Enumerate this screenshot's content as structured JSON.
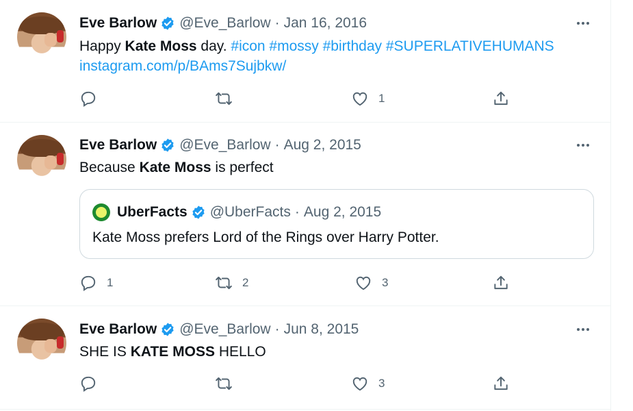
{
  "tweets": [
    {
      "author": {
        "name": "Eve Barlow",
        "handle": "@Eve_Barlow"
      },
      "date": "Jan 16, 2016",
      "text": {
        "t1": "Happy ",
        "b1": "Kate Moss",
        "t2": " day. ",
        "link1": "#icon #mossy #birthday #SUPERLATIVEHUMANS",
        "link2": "instagram.com/p/BAms7Sujbkw/"
      },
      "replies": "",
      "retweets": "",
      "likes": "1"
    },
    {
      "author": {
        "name": "Eve Barlow",
        "handle": "@Eve_Barlow"
      },
      "date": "Aug 2, 2015",
      "text": {
        "t1": "Because ",
        "b1": "Kate Moss",
        "t2": " is perfect"
      },
      "quote": {
        "name": "UberFacts",
        "handle": "@UberFacts",
        "date": "Aug 2, 2015",
        "text": "Kate Moss prefers Lord of the Rings over Harry Potter."
      },
      "replies": "1",
      "retweets": "2",
      "likes": "3"
    },
    {
      "author": {
        "name": "Eve Barlow",
        "handle": "@Eve_Barlow"
      },
      "date": "Jun 8, 2015",
      "text": {
        "t1": "SHE IS ",
        "b1": "KATE MOSS",
        "t2": " HELLO"
      },
      "replies": "",
      "retweets": "",
      "likes": "3"
    }
  ],
  "separator": "·",
  "icons": [
    "verified-badge-icon",
    "more-icon",
    "reply-icon",
    "retweet-icon",
    "like-icon",
    "share-icon"
  ],
  "colors": {
    "link": "#1d9bf0",
    "verified": "#1d9bf0",
    "muted": "#536471"
  }
}
